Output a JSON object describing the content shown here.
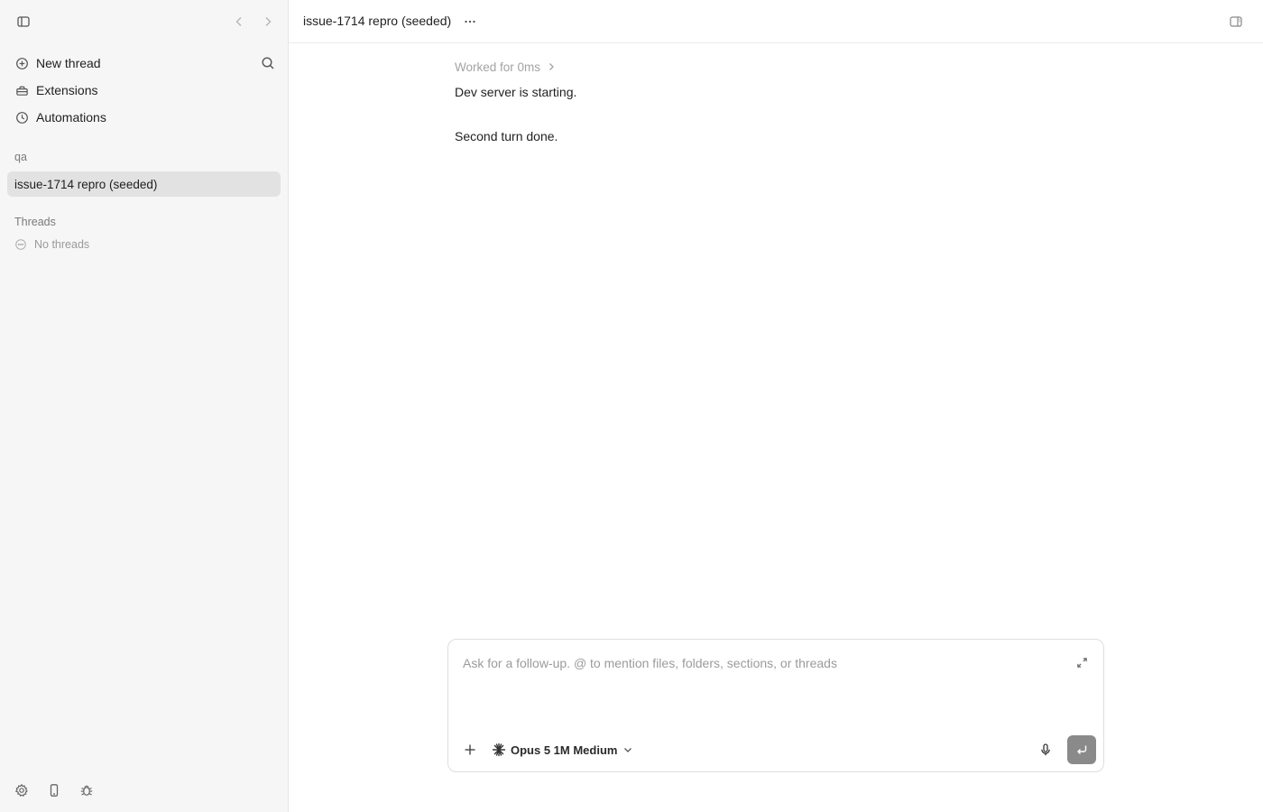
{
  "sidebar": {
    "items": [
      {
        "label": "New thread",
        "icon": "plus-circle-icon"
      },
      {
        "label": "Extensions",
        "icon": "toolbox-icon"
      },
      {
        "label": "Automations",
        "icon": "clock-icon"
      }
    ],
    "project_section": "qa",
    "active_project": "issue-1714 repro (seeded)",
    "threads_section": "Threads",
    "empty_threads": "No threads"
  },
  "header": {
    "title": "issue-1714 repro (seeded)"
  },
  "conversation": {
    "worked_label": "Worked for 0ms",
    "messages": [
      "Dev server is starting.",
      "Second turn done."
    ]
  },
  "composer": {
    "placeholder": "Ask for a follow-up. @ to mention files, folders, sections, or threads",
    "value": "",
    "model": "Opus 5 1M Medium"
  },
  "colors": {
    "sidebar_bg": "#f6f6f6",
    "active_item_bg": "#e2e2e2",
    "send_button_bg": "#8a8a8a"
  }
}
